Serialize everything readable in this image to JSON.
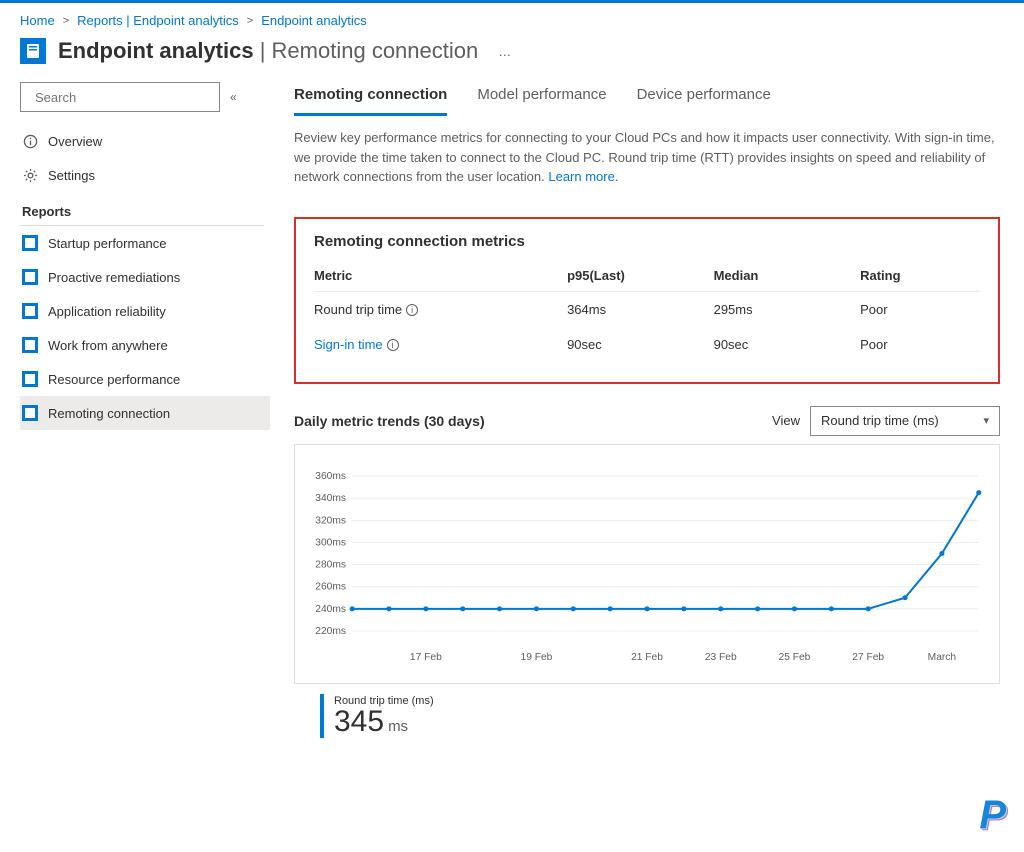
{
  "breadcrumb": {
    "home": "Home",
    "reports": "Reports | Endpoint analytics",
    "current": "Endpoint analytics"
  },
  "header": {
    "title_main": "Endpoint analytics",
    "title_sep": " | ",
    "title_sub": "Remoting connection",
    "more": "…"
  },
  "sidebar": {
    "search_placeholder": "Search",
    "overview": "Overview",
    "settings": "Settings",
    "section_title": "Reports",
    "items": [
      {
        "label": "Startup performance"
      },
      {
        "label": "Proactive remediations"
      },
      {
        "label": "Application reliability"
      },
      {
        "label": "Work from anywhere"
      },
      {
        "label": "Resource performance"
      },
      {
        "label": "Remoting connection"
      }
    ]
  },
  "tabs": [
    {
      "label": "Remoting connection",
      "active": true
    },
    {
      "label": "Model performance"
    },
    {
      "label": "Device performance"
    }
  ],
  "description": {
    "text": "Review key performance metrics for connecting to your Cloud PCs and how it impacts user connectivity. With sign-in time, we provide the time taken to connect to the Cloud PC. Round trip time (RTT) provides insights on speed and reliability of network connections from the user location. ",
    "learn_more": "Learn more."
  },
  "metrics_card": {
    "title": "Remoting connection metrics",
    "columns": {
      "metric": "Metric",
      "p95": "p95(Last)",
      "median": "Median",
      "rating": "Rating"
    },
    "rows": [
      {
        "metric": "Round trip time",
        "is_link": false,
        "p95": "364ms",
        "median": "295ms",
        "rating": "Poor"
      },
      {
        "metric": "Sign-in time",
        "is_link": true,
        "p95": "90sec",
        "median": "90sec",
        "rating": "Poor"
      }
    ]
  },
  "trends": {
    "title": "Daily metric trends (30 days)",
    "view_label": "View",
    "view_selected": "Round trip time (ms)"
  },
  "slab": {
    "label": "Round trip time (ms)",
    "value": "345",
    "unit": "ms"
  },
  "brand_letter": "P",
  "chart_data": {
    "type": "line",
    "title": "Daily metric trends (30 days)",
    "xlabel": "",
    "ylabel": "",
    "ylim": [
      210,
      370
    ],
    "yticks": [
      "220ms",
      "240ms",
      "260ms",
      "280ms",
      "300ms",
      "320ms",
      "340ms",
      "360ms"
    ],
    "xticks": [
      "17 Feb",
      "19 Feb",
      "21 Feb",
      "23 Feb",
      "25 Feb",
      "27 Feb",
      "March"
    ],
    "x": [
      0,
      1,
      2,
      3,
      4,
      5,
      6,
      7,
      8,
      9,
      10,
      11,
      12,
      13,
      14,
      15,
      16,
      17
    ],
    "values": [
      240,
      240,
      240,
      240,
      240,
      240,
      240,
      240,
      240,
      240,
      240,
      240,
      240,
      240,
      240,
      250,
      290,
      345
    ]
  }
}
